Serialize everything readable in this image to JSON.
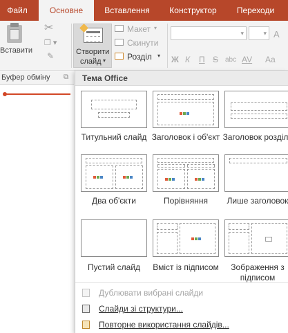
{
  "tabs": [
    {
      "label": "Файл",
      "active": false
    },
    {
      "label": "Основне",
      "active": true
    },
    {
      "label": "Вставлення",
      "active": false
    },
    {
      "label": "Конструктор",
      "active": false
    },
    {
      "label": "Переходи",
      "active": false
    }
  ],
  "ribbon": {
    "clipboard": {
      "paste_label": "Вставити",
      "group_label": "Буфер обміну"
    },
    "slides": {
      "new_slide_line1": "Створити",
      "new_slide_line2": "слайд",
      "layout_label": "Макет",
      "reset_label": "Скинути",
      "section_label": "Розділ"
    },
    "font": {
      "grow_label": "A",
      "bold": "Ж",
      "italic": "К",
      "underline": "П",
      "strike": "S",
      "shadow": "abc",
      "spacing": "AV",
      "case": "Aa"
    }
  },
  "gallery": {
    "header": "Тема Office",
    "layouts": [
      {
        "id": "title",
        "label": "Титульний слайд"
      },
      {
        "id": "title-content",
        "label": "Заголовок і об'єкт"
      },
      {
        "id": "section",
        "label": "Заголовок розділу"
      },
      {
        "id": "two-content",
        "label": "Два об'єкти"
      },
      {
        "id": "comparison",
        "label": "Порівняння"
      },
      {
        "id": "title-only",
        "label": "Лише заголовок"
      },
      {
        "id": "blank",
        "label": "Пустий слайд"
      },
      {
        "id": "content-caption",
        "label": "Вміст із підписом"
      },
      {
        "id": "picture-caption",
        "label": "Зображення з підписом"
      }
    ],
    "menu": [
      {
        "label": "Дублювати вибрані слайди",
        "enabled": false
      },
      {
        "label": "Слайди зі структури...",
        "enabled": true
      },
      {
        "label": "Повторне використання слайдів...",
        "enabled": true
      }
    ]
  },
  "colors": {
    "accent": "#b7472a",
    "highlight": "#d24726",
    "picto_red": "#e05a3a",
    "picto_green": "#6aa84f",
    "picto_blue": "#4a86c5",
    "picto_yellow": "#f0b84a"
  }
}
